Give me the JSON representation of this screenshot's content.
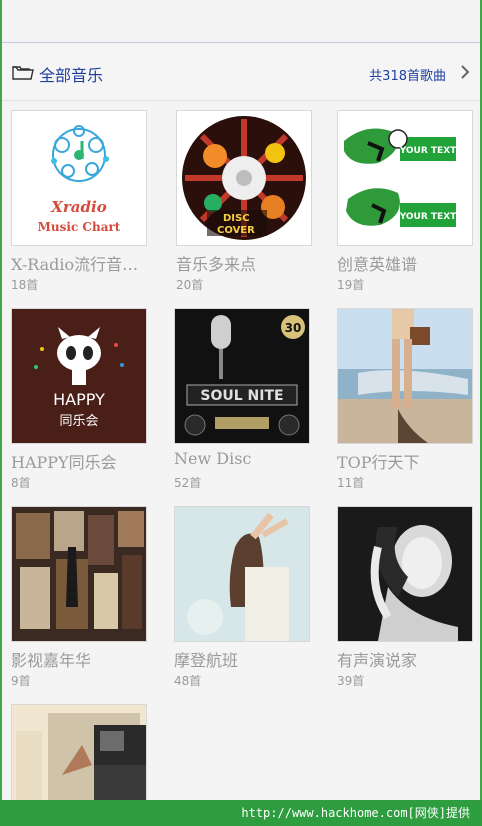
{
  "header": {
    "title": "全部音乐",
    "count": "共318首歌曲"
  },
  "tiles": [
    {
      "title": "X-Radio流行音…",
      "count": "18首",
      "art_text_1": "Xradio",
      "art_text_2": "Music Chart"
    },
    {
      "title": "音乐多来点",
      "count": "20首",
      "art_text_1": "DISC",
      "art_text_2": "COVER"
    },
    {
      "title": "创意英雄谱",
      "count": "19首",
      "art_text_1": "YOUR TEXT",
      "art_text_2": "YOUR TEXT"
    },
    {
      "title": "HAPPY同乐会",
      "count": "8首",
      "art_text_1": "HAPPY",
      "art_text_2": "同乐会"
    },
    {
      "title": "New Disc",
      "count": "52首",
      "art_text_1": "SOUL NITE",
      "art_text_2": "30"
    },
    {
      "title": "TOP行天下",
      "count": "11首"
    },
    {
      "title": "影视嘉年华",
      "count": "9首"
    },
    {
      "title": "摩登航班",
      "count": "48首"
    },
    {
      "title": "有声演说家",
      "count": "39首"
    },
    {
      "title": "",
      "count": ""
    }
  ],
  "watermark": "http://www.hackhome.com[网侠]提供"
}
